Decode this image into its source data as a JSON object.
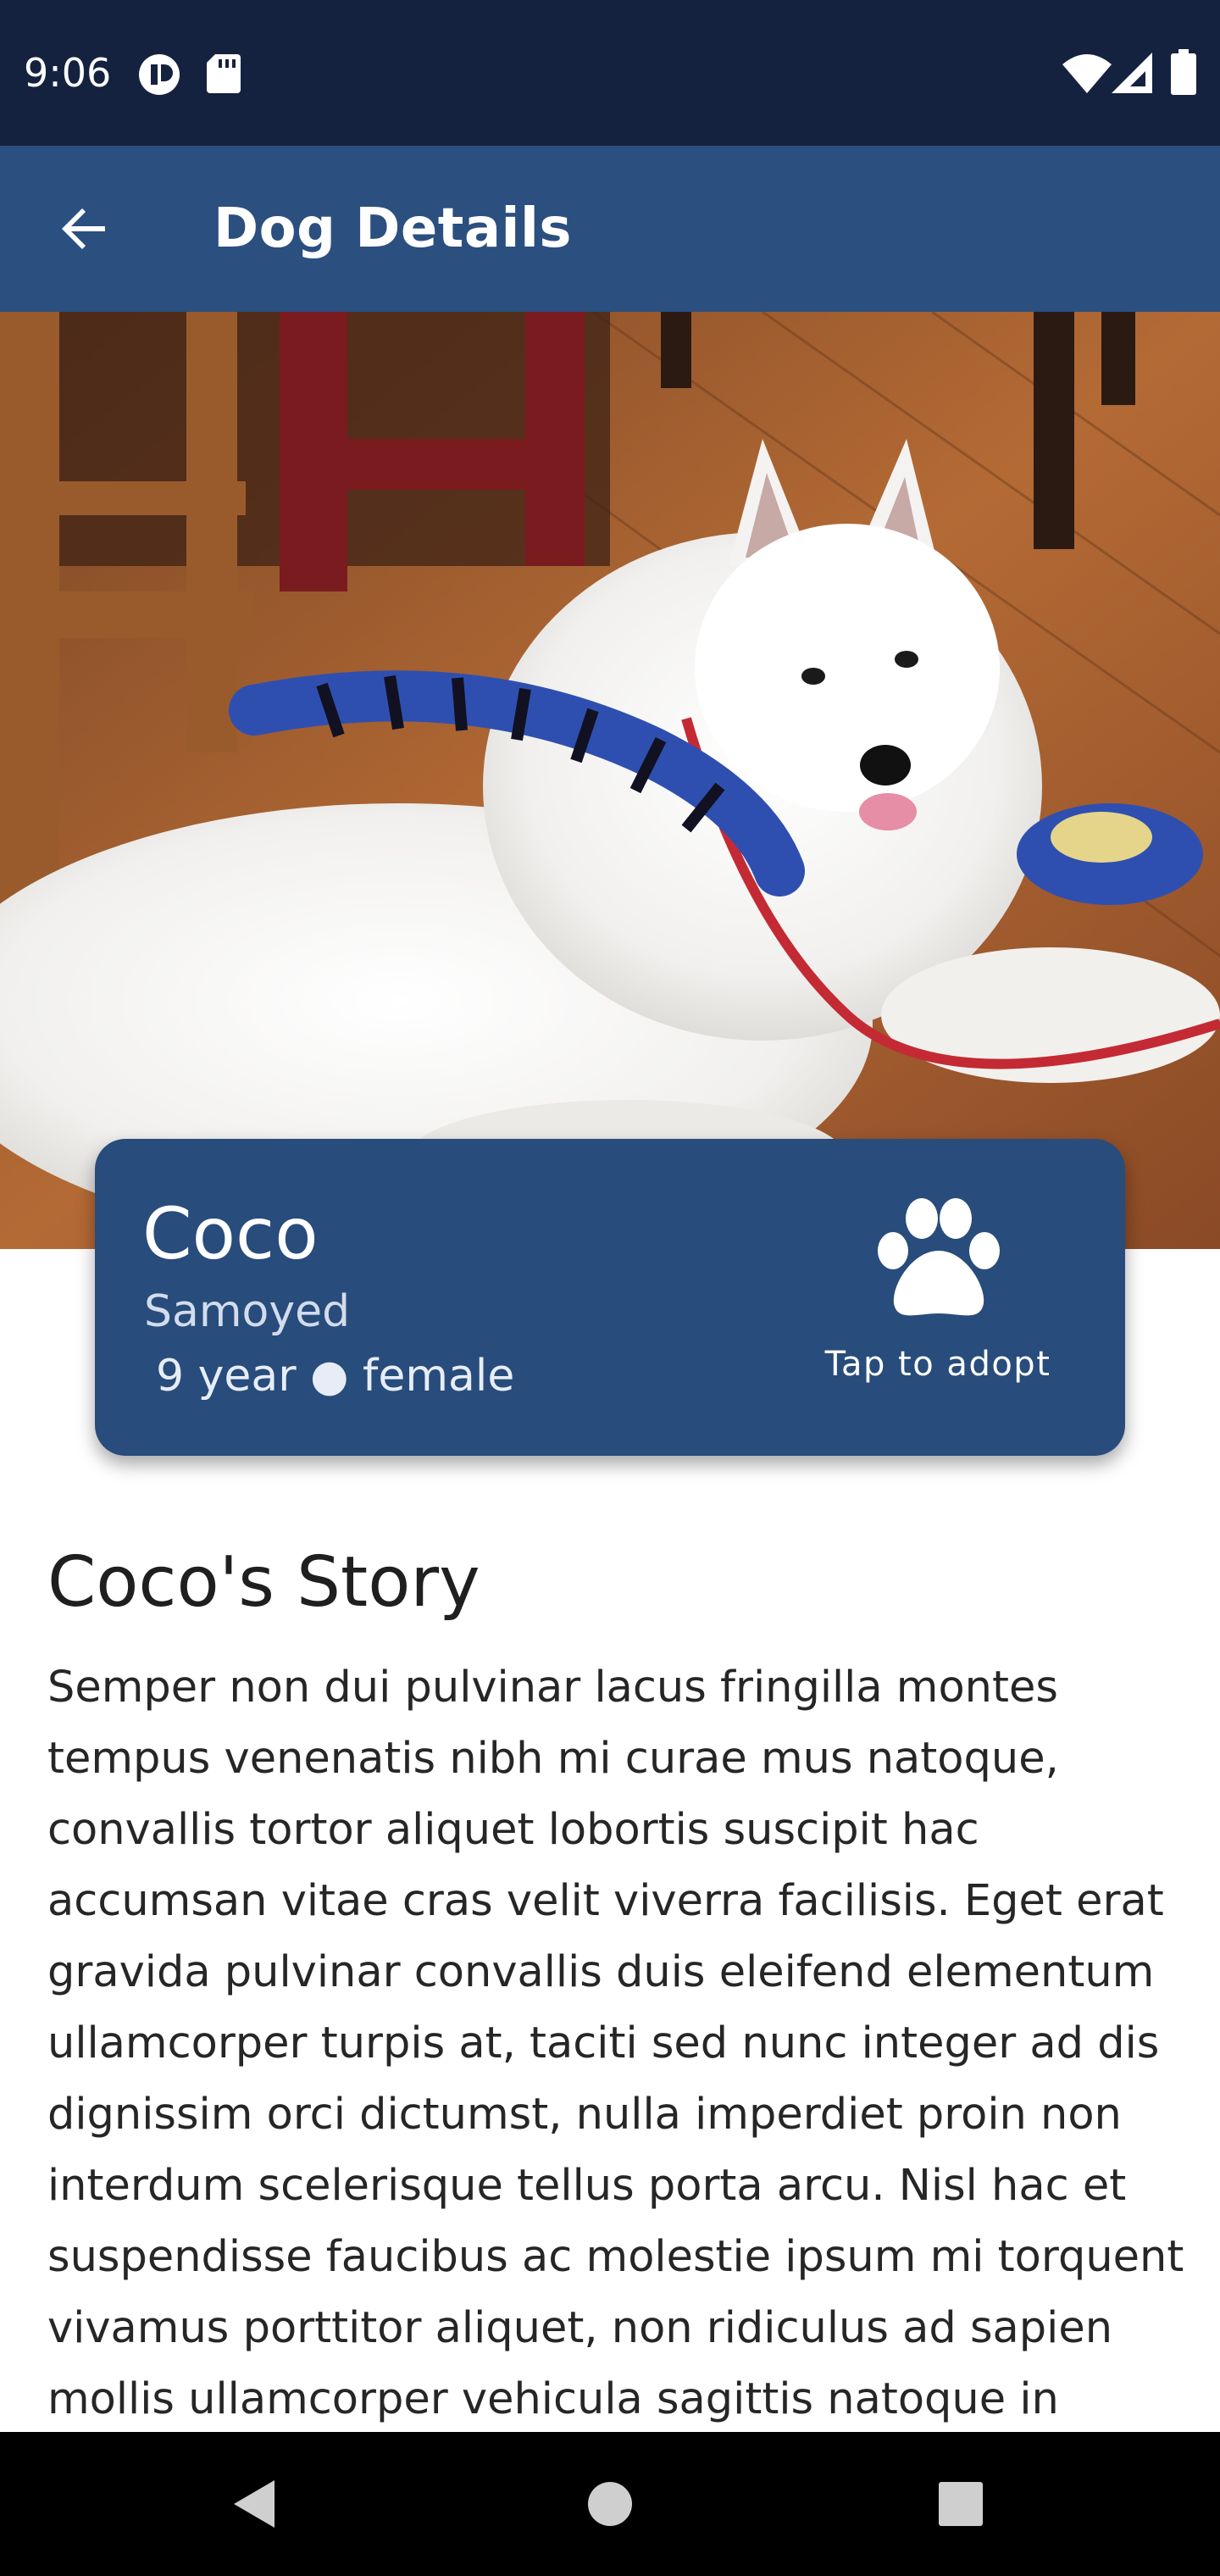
{
  "status_bar": {
    "time": "9:06",
    "icons": [
      "notification-icon",
      "sd-card-icon",
      "wifi-icon",
      "cellular-signal-icon",
      "battery-icon"
    ]
  },
  "app_bar": {
    "title": "Dog Details",
    "back_icon": "arrow-back-icon"
  },
  "hero": {
    "subject": "white samoyed puppy lying on wooden floor with blue striped toy"
  },
  "dog": {
    "name": "Coco",
    "breed": "Samoyed",
    "meta": "9 year ● female"
  },
  "adopt": {
    "icon": "paw-icon",
    "label": "Tap to adopt"
  },
  "story": {
    "title": "Coco's Story",
    "lines": [
      "Semper non dui pulvinar lacus fringilla montes",
      "tempus venenatis nibh mi curae mus natoque,",
      "convallis tortor aliquet lobortis suscipit hac",
      "accumsan vitae cras velit viverra facilisis. Eget erat",
      "gravida pulvinar convallis duis eleifend elementum",
      "ullamcorper turpis at, taciti sed nunc integer ad dis",
      "dignissim orci dictumst, nulla imperdiet proin non",
      "interdum scelerisque tellus porta arcu. Nisl hac et",
      "suspendisse faucibus ac molestie ipsum mi torquent",
      "vivamus porttitor aliquet, non ridiculus ad sapien",
      "mollis ullamcorper vehicula sagittis natoque in"
    ]
  },
  "nav_bar": {
    "icons": [
      "nav-back-icon",
      "nav-home-icon",
      "nav-recents-icon"
    ]
  },
  "colors": {
    "status_bar": "#14223f",
    "app_bar": "#2b4f7f",
    "card": "#284c7b",
    "text_dark": "#262626"
  }
}
